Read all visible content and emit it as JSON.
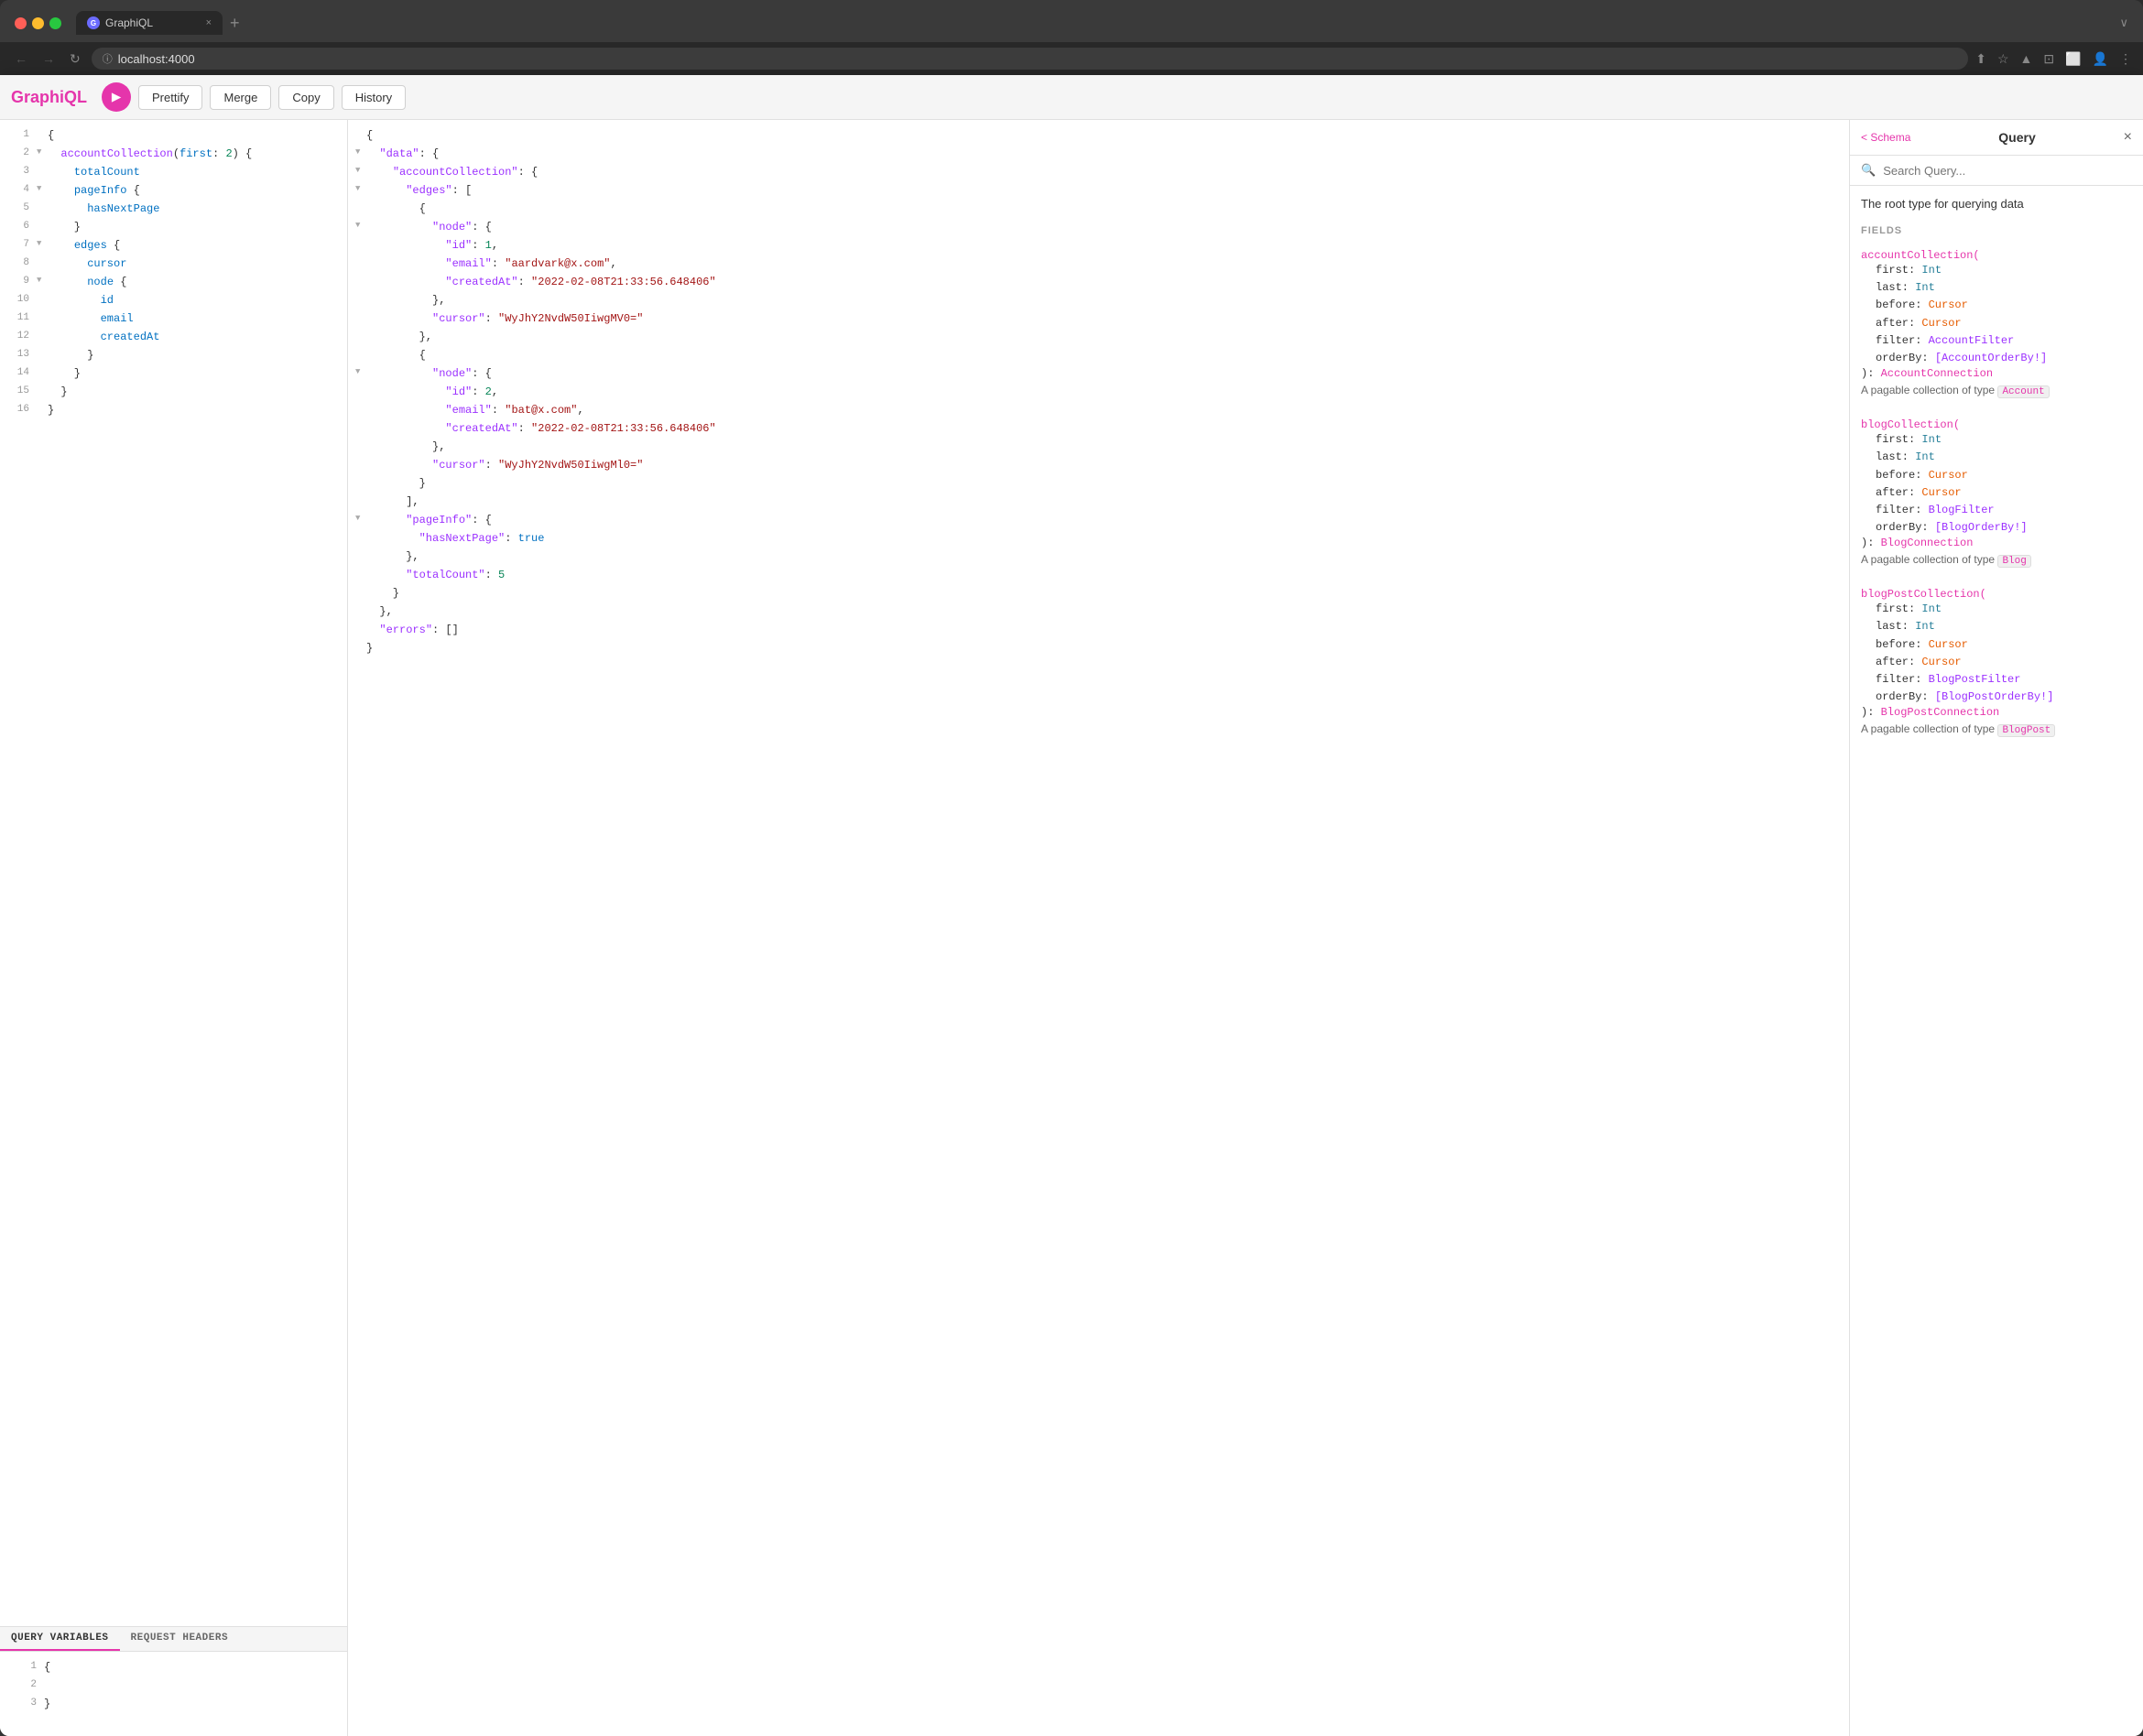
{
  "browser": {
    "tab_title": "GraphiQL",
    "tab_close": "×",
    "tab_new": "+",
    "tab_chevron": "∨",
    "url": "localhost:4000",
    "nav_back": "←",
    "nav_forward": "→",
    "nav_refresh": "↻"
  },
  "toolbar": {
    "logo": "GraphiQL",
    "run_label": "▶",
    "prettify_label": "Prettify",
    "merge_label": "Merge",
    "copy_label": "Copy",
    "history_label": "History"
  },
  "query_editor": {
    "lines": [
      {
        "num": "1",
        "fold": "",
        "content": "{",
        "parts": [
          {
            "text": "{",
            "cls": "c-dark"
          }
        ]
      },
      {
        "num": "2",
        "fold": "▼",
        "content": "  accountCollection(first: 2) {",
        "parts": [
          {
            "text": "  ",
            "cls": ""
          },
          {
            "text": "accountCollection",
            "cls": "c-purple"
          },
          {
            "text": "(",
            "cls": "c-dark"
          },
          {
            "text": "first",
            "cls": "c-blue"
          },
          {
            "text": ": ",
            "cls": "c-dark"
          },
          {
            "text": "2",
            "cls": "c-json-num"
          },
          {
            "text": ") {",
            "cls": "c-dark"
          }
        ]
      },
      {
        "num": "3",
        "fold": "",
        "content": "    totalCount",
        "parts": [
          {
            "text": "    totalCount",
            "cls": "c-blue"
          }
        ]
      },
      {
        "num": "4",
        "fold": "▼",
        "content": "    pageInfo {",
        "parts": [
          {
            "text": "    ",
            "cls": ""
          },
          {
            "text": "pageInfo",
            "cls": "c-blue"
          },
          {
            "text": " {",
            "cls": "c-dark"
          }
        ]
      },
      {
        "num": "5",
        "fold": "",
        "content": "      hasNextPage",
        "parts": [
          {
            "text": "      hasNextPage",
            "cls": "c-blue"
          }
        ]
      },
      {
        "num": "6",
        "fold": "",
        "content": "    }",
        "parts": [
          {
            "text": "    }",
            "cls": "c-dark"
          }
        ]
      },
      {
        "num": "7",
        "fold": "▼",
        "content": "    edges {",
        "parts": [
          {
            "text": "    ",
            "cls": ""
          },
          {
            "text": "edges",
            "cls": "c-blue"
          },
          {
            "text": " {",
            "cls": "c-dark"
          }
        ]
      },
      {
        "num": "8",
        "fold": "",
        "content": "      cursor",
        "parts": [
          {
            "text": "      cursor",
            "cls": "c-blue"
          }
        ]
      },
      {
        "num": "9",
        "fold": "▼",
        "content": "      node {",
        "parts": [
          {
            "text": "      ",
            "cls": ""
          },
          {
            "text": "node",
            "cls": "c-blue"
          },
          {
            "text": " {",
            "cls": "c-dark"
          }
        ]
      },
      {
        "num": "10",
        "fold": "",
        "content": "        id",
        "parts": [
          {
            "text": "        id",
            "cls": "c-blue"
          }
        ]
      },
      {
        "num": "11",
        "fold": "",
        "content": "        email",
        "parts": [
          {
            "text": "        email",
            "cls": "c-blue"
          }
        ]
      },
      {
        "num": "12",
        "fold": "",
        "content": "        createdAt",
        "parts": [
          {
            "text": "        createdAt",
            "cls": "c-blue"
          }
        ]
      },
      {
        "num": "13",
        "fold": "",
        "content": "      }",
        "parts": [
          {
            "text": "      }",
            "cls": "c-dark"
          }
        ]
      },
      {
        "num": "14",
        "fold": "",
        "content": "    }",
        "parts": [
          {
            "text": "    }",
            "cls": "c-dark"
          }
        ]
      },
      {
        "num": "15",
        "fold": "",
        "content": "  }",
        "parts": [
          {
            "text": "  }",
            "cls": "c-dark"
          }
        ]
      },
      {
        "num": "16",
        "fold": "",
        "content": "}",
        "parts": [
          {
            "text": "}",
            "cls": "c-dark"
          }
        ]
      }
    ]
  },
  "variables_panel": {
    "tab_query_variables": "QUERY VARIABLES",
    "tab_request_headers": "REQUEST HEADERS",
    "lines": [
      {
        "num": "1",
        "content": "{"
      },
      {
        "num": "2",
        "content": ""
      },
      {
        "num": "3",
        "content": "}"
      }
    ]
  },
  "response": {
    "lines": [
      {
        "indent": 0,
        "fold": "",
        "parts": [
          {
            "text": "{",
            "cls": "c-dark"
          }
        ]
      },
      {
        "indent": 1,
        "fold": "▼",
        "parts": [
          {
            "text": "  ",
            "cls": ""
          },
          {
            "text": "\"data\"",
            "cls": "c-json-key"
          },
          {
            "text": ": {",
            "cls": "c-dark"
          }
        ]
      },
      {
        "indent": 2,
        "fold": "▼",
        "parts": [
          {
            "text": "    ",
            "cls": ""
          },
          {
            "text": "\"accountCollection\"",
            "cls": "c-json-key"
          },
          {
            "text": ": {",
            "cls": "c-dark"
          }
        ]
      },
      {
        "indent": 3,
        "fold": "▼",
        "parts": [
          {
            "text": "      ",
            "cls": ""
          },
          {
            "text": "\"edges\"",
            "cls": "c-json-key"
          },
          {
            "text": ": [",
            "cls": "c-dark"
          }
        ]
      },
      {
        "indent": 4,
        "fold": "",
        "parts": [
          {
            "text": "        {",
            "cls": "c-dark"
          }
        ]
      },
      {
        "indent": 5,
        "fold": "▼",
        "parts": [
          {
            "text": "          ",
            "cls": ""
          },
          {
            "text": "\"node\"",
            "cls": "c-json-key"
          },
          {
            "text": ": {",
            "cls": "c-dark"
          }
        ]
      },
      {
        "indent": 6,
        "fold": "",
        "parts": [
          {
            "text": "            ",
            "cls": ""
          },
          {
            "text": "\"id\"",
            "cls": "c-json-key"
          },
          {
            "text": ": ",
            "cls": "c-dark"
          },
          {
            "text": "1",
            "cls": "c-json-num"
          },
          {
            "text": ",",
            "cls": "c-dark"
          }
        ]
      },
      {
        "indent": 6,
        "fold": "",
        "parts": [
          {
            "text": "            ",
            "cls": ""
          },
          {
            "text": "\"email\"",
            "cls": "c-json-key"
          },
          {
            "text": ": ",
            "cls": "c-dark"
          },
          {
            "text": "\"aardvark@x.com\"",
            "cls": "c-json-str"
          },
          {
            "text": ",",
            "cls": "c-dark"
          }
        ]
      },
      {
        "indent": 6,
        "fold": "",
        "parts": [
          {
            "text": "            ",
            "cls": ""
          },
          {
            "text": "\"createdAt\"",
            "cls": "c-json-key"
          },
          {
            "text": ": ",
            "cls": "c-dark"
          },
          {
            "text": "\"2022-02-08T21:33:56.648406\"",
            "cls": "c-json-str"
          }
        ]
      },
      {
        "indent": 5,
        "fold": "",
        "parts": [
          {
            "text": "          },",
            "cls": "c-dark"
          }
        ]
      },
      {
        "indent": 5,
        "fold": "",
        "parts": [
          {
            "text": "          ",
            "cls": ""
          },
          {
            "text": "\"cursor\"",
            "cls": "c-json-key"
          },
          {
            "text": ": ",
            "cls": "c-dark"
          },
          {
            "text": "\"WyJhY2NvdW50IiwgMV0=\"",
            "cls": "c-json-str"
          }
        ]
      },
      {
        "indent": 4,
        "fold": "",
        "parts": [
          {
            "text": "        },",
            "cls": "c-dark"
          }
        ]
      },
      {
        "indent": 4,
        "fold": "",
        "parts": [
          {
            "text": "        {",
            "cls": "c-dark"
          }
        ]
      },
      {
        "indent": 5,
        "fold": "▼",
        "parts": [
          {
            "text": "          ",
            "cls": ""
          },
          {
            "text": "\"node\"",
            "cls": "c-json-key"
          },
          {
            "text": ": {",
            "cls": "c-dark"
          }
        ]
      },
      {
        "indent": 6,
        "fold": "",
        "parts": [
          {
            "text": "            ",
            "cls": ""
          },
          {
            "text": "\"id\"",
            "cls": "c-json-key"
          },
          {
            "text": ": ",
            "cls": "c-dark"
          },
          {
            "text": "2",
            "cls": "c-json-num"
          },
          {
            "text": ",",
            "cls": "c-dark"
          }
        ]
      },
      {
        "indent": 6,
        "fold": "",
        "parts": [
          {
            "text": "            ",
            "cls": ""
          },
          {
            "text": "\"email\"",
            "cls": "c-json-key"
          },
          {
            "text": ": ",
            "cls": "c-dark"
          },
          {
            "text": "\"bat@x.com\"",
            "cls": "c-json-str"
          },
          {
            "text": ",",
            "cls": "c-dark"
          }
        ]
      },
      {
        "indent": 6,
        "fold": "",
        "parts": [
          {
            "text": "            ",
            "cls": ""
          },
          {
            "text": "\"createdAt\"",
            "cls": "c-json-key"
          },
          {
            "text": ": ",
            "cls": "c-dark"
          },
          {
            "text": "\"2022-02-08T21:33:56.648406\"",
            "cls": "c-json-str"
          }
        ]
      },
      {
        "indent": 5,
        "fold": "",
        "parts": [
          {
            "text": "          },",
            "cls": "c-dark"
          }
        ]
      },
      {
        "indent": 5,
        "fold": "",
        "parts": [
          {
            "text": "          ",
            "cls": ""
          },
          {
            "text": "\"cursor\"",
            "cls": "c-json-key"
          },
          {
            "text": ": ",
            "cls": "c-dark"
          },
          {
            "text": "\"WyJhY2NvdW50IiwgMl0=\"",
            "cls": "c-json-str"
          }
        ]
      },
      {
        "indent": 4,
        "fold": "",
        "parts": [
          {
            "text": "        }",
            "cls": "c-dark"
          }
        ]
      },
      {
        "indent": 3,
        "fold": "",
        "parts": [
          {
            "text": "      ],",
            "cls": "c-dark"
          }
        ]
      },
      {
        "indent": 3,
        "fold": "▼",
        "parts": [
          {
            "text": "      ",
            "cls": ""
          },
          {
            "text": "\"pageInfo\"",
            "cls": "c-json-key"
          },
          {
            "text": ": {",
            "cls": "c-dark"
          }
        ]
      },
      {
        "indent": 4,
        "fold": "",
        "parts": [
          {
            "text": "        ",
            "cls": ""
          },
          {
            "text": "\"hasNextPage\"",
            "cls": "c-json-key"
          },
          {
            "text": ": ",
            "cls": "c-dark"
          },
          {
            "text": "true",
            "cls": "c-json-bool"
          }
        ]
      },
      {
        "indent": 3,
        "fold": "",
        "parts": [
          {
            "text": "      },",
            "cls": "c-dark"
          }
        ]
      },
      {
        "indent": 3,
        "fold": "",
        "parts": [
          {
            "text": "      ",
            "cls": ""
          },
          {
            "text": "\"totalCount\"",
            "cls": "c-json-key"
          },
          {
            "text": ": ",
            "cls": "c-dark"
          },
          {
            "text": "5",
            "cls": "c-json-num"
          }
        ]
      },
      {
        "indent": 2,
        "fold": "",
        "parts": [
          {
            "text": "    }",
            "cls": "c-dark"
          }
        ]
      },
      {
        "indent": 1,
        "fold": "",
        "parts": [
          {
            "text": "  },",
            "cls": "c-dark"
          }
        ]
      },
      {
        "indent": 1,
        "fold": "",
        "parts": [
          {
            "text": "  ",
            "cls": ""
          },
          {
            "text": "\"errors\"",
            "cls": "c-json-key"
          },
          {
            "text": ": []",
            "cls": "c-dark"
          }
        ]
      },
      {
        "indent": 0,
        "fold": "",
        "parts": [
          {
            "text": "}",
            "cls": "c-dark"
          }
        ]
      }
    ]
  },
  "schema_panel": {
    "back_label": "< Schema",
    "title": "Query",
    "close_label": "×",
    "search_placeholder": "Search Query...",
    "description": "The root type for querying data",
    "fields_label": "FIELDS",
    "fields": [
      {
        "name": "accountCollection(",
        "params": [
          {
            "name": "first",
            "type": "Int"
          },
          {
            "name": "last",
            "type": "Int"
          },
          {
            "name": "before",
            "type": "Cursor"
          },
          {
            "name": "after",
            "type": "Cursor"
          },
          {
            "name": "filter",
            "type": "AccountFilter"
          },
          {
            "name": "orderBy",
            "type": "[AccountOrderBy!]"
          }
        ],
        "return_prefix": "): ",
        "return_type": "AccountConnection",
        "description": "A pagable collection of type ",
        "type_badge": "Account"
      },
      {
        "name": "blogCollection(",
        "params": [
          {
            "name": "first",
            "type": "Int"
          },
          {
            "name": "last",
            "type": "Int"
          },
          {
            "name": "before",
            "type": "Cursor"
          },
          {
            "name": "after",
            "type": "Cursor"
          },
          {
            "name": "filter",
            "type": "BlogFilter"
          },
          {
            "name": "orderBy",
            "type": "[BlogOrderBy!]"
          }
        ],
        "return_prefix": "): ",
        "return_type": "BlogConnection",
        "description": "A pagable collection of type ",
        "type_badge": "Blog"
      },
      {
        "name": "blogPostCollection(",
        "params": [
          {
            "name": "first",
            "type": "Int"
          },
          {
            "name": "last",
            "type": "Int"
          },
          {
            "name": "before",
            "type": "Cursor"
          },
          {
            "name": "after",
            "type": "Cursor"
          },
          {
            "name": "filter",
            "type": "BlogPostFilter"
          },
          {
            "name": "orderBy",
            "type": "[BlogPostOrderBy!]"
          }
        ],
        "return_prefix": "): ",
        "return_type": "BlogPostConnection",
        "description": "A pagable collection of type ",
        "type_badge": "BlogPost"
      }
    ]
  }
}
